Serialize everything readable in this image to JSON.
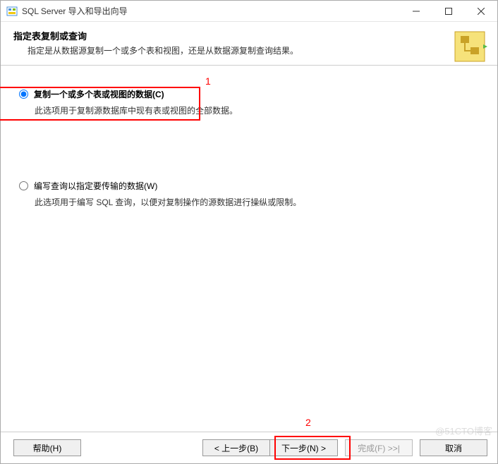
{
  "titlebar": {
    "title": "SQL Server 导入和导出向导"
  },
  "header": {
    "title": "指定表复制或查询",
    "subtitle": "指定是从数据源复制一个或多个表和视图，还是从数据源复制查询结果。"
  },
  "options": {
    "copy_tables": {
      "label": "复制一个或多个表或视图的数据(C)",
      "description": "此选项用于复制源数据库中现有表或视图的全部数据。",
      "selected": true
    },
    "write_query": {
      "label": "编写查询以指定要传输的数据(W)",
      "description": "此选项用于编写 SQL 查询，以便对复制操作的源数据进行操纵或限制。",
      "selected": false
    }
  },
  "annotations": {
    "marker1": "1",
    "marker2": "2"
  },
  "footer": {
    "help": "帮助(H)",
    "back": "< 上一步(B)",
    "next": "下一步(N) >",
    "finish": "完成(F) >>|",
    "cancel": "取消"
  },
  "watermark": "@51CTO博客"
}
